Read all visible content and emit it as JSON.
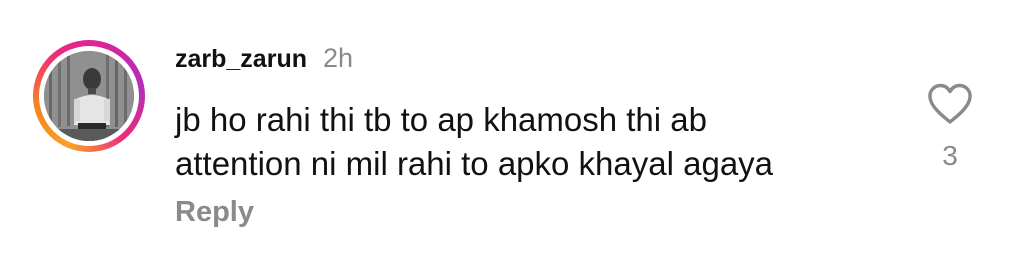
{
  "comment": {
    "username": "zarb_zarun",
    "timestamp": "2h",
    "text_lines": [
      "jb ho rahi thi tb to ap khamosh thi ab",
      "attention ni mil rahi to apko khayal agaya"
    ],
    "reply_label": "Reply",
    "like_count": "3",
    "like_icon": "heart-outline-icon",
    "story_ring_colors": [
      "#f9a12b",
      "#ee2a7b",
      "#d6249f"
    ]
  }
}
